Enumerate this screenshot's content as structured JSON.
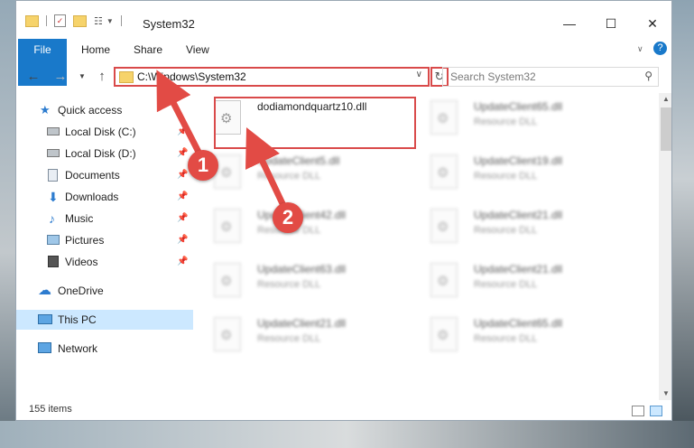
{
  "window": {
    "title": "System32"
  },
  "ribbon": {
    "tabs": [
      "File",
      "Home",
      "Share",
      "View"
    ]
  },
  "address": {
    "path": "C:\\Windows\\System32"
  },
  "search": {
    "placeholder": "Search System32"
  },
  "sidebar": {
    "items": [
      {
        "label": "Quick access",
        "icon": "star-icon"
      },
      {
        "label": "Local Disk (C:)",
        "icon": "drive-icon",
        "pinned": true
      },
      {
        "label": "Local Disk (D:)",
        "icon": "drive-icon",
        "pinned": true
      },
      {
        "label": "Documents",
        "icon": "documents-icon",
        "pinned": true
      },
      {
        "label": "Downloads",
        "icon": "downloads-icon",
        "pinned": true
      },
      {
        "label": "Music",
        "icon": "music-icon",
        "pinned": true
      },
      {
        "label": "Pictures",
        "icon": "pictures-icon",
        "pinned": true
      },
      {
        "label": "Videos",
        "icon": "videos-icon",
        "pinned": true
      },
      {
        "label": "OneDrive",
        "icon": "cloud-icon"
      },
      {
        "label": "This PC",
        "icon": "computer-icon",
        "selected": true
      },
      {
        "label": "Network",
        "icon": "network-icon"
      }
    ]
  },
  "files": {
    "highlighted": {
      "name": "dodiamondquartz10.dll"
    },
    "blurred": [
      {
        "name": "UpdateClient65.dll",
        "type": "Resource DLL"
      },
      {
        "name": "UpdateClient5.dll",
        "type": "Resource DLL"
      },
      {
        "name": "UpdateClient19.dll",
        "type": "Resource DLL"
      },
      {
        "name": "UpdateClient42.dll",
        "type": "Resource DLL"
      },
      {
        "name": "UpdateClient21.dll",
        "type": "Resource DLL"
      },
      {
        "name": "UpdateClient63.dll",
        "type": "Resource DLL"
      },
      {
        "name": "UpdateClient21.dll",
        "type": "Resource DLL"
      },
      {
        "name": "UpdateClient21.dll",
        "type": "Resource DLL"
      },
      {
        "name": "UpdateClient65.dll",
        "type": "Resource DLL"
      }
    ]
  },
  "status": {
    "count": "155 items"
  },
  "annotations": {
    "badge1": "1",
    "badge2": "2"
  },
  "colors": {
    "accent": "#1979ca",
    "annotation": "#e24b45",
    "selection": "#cce8ff"
  }
}
